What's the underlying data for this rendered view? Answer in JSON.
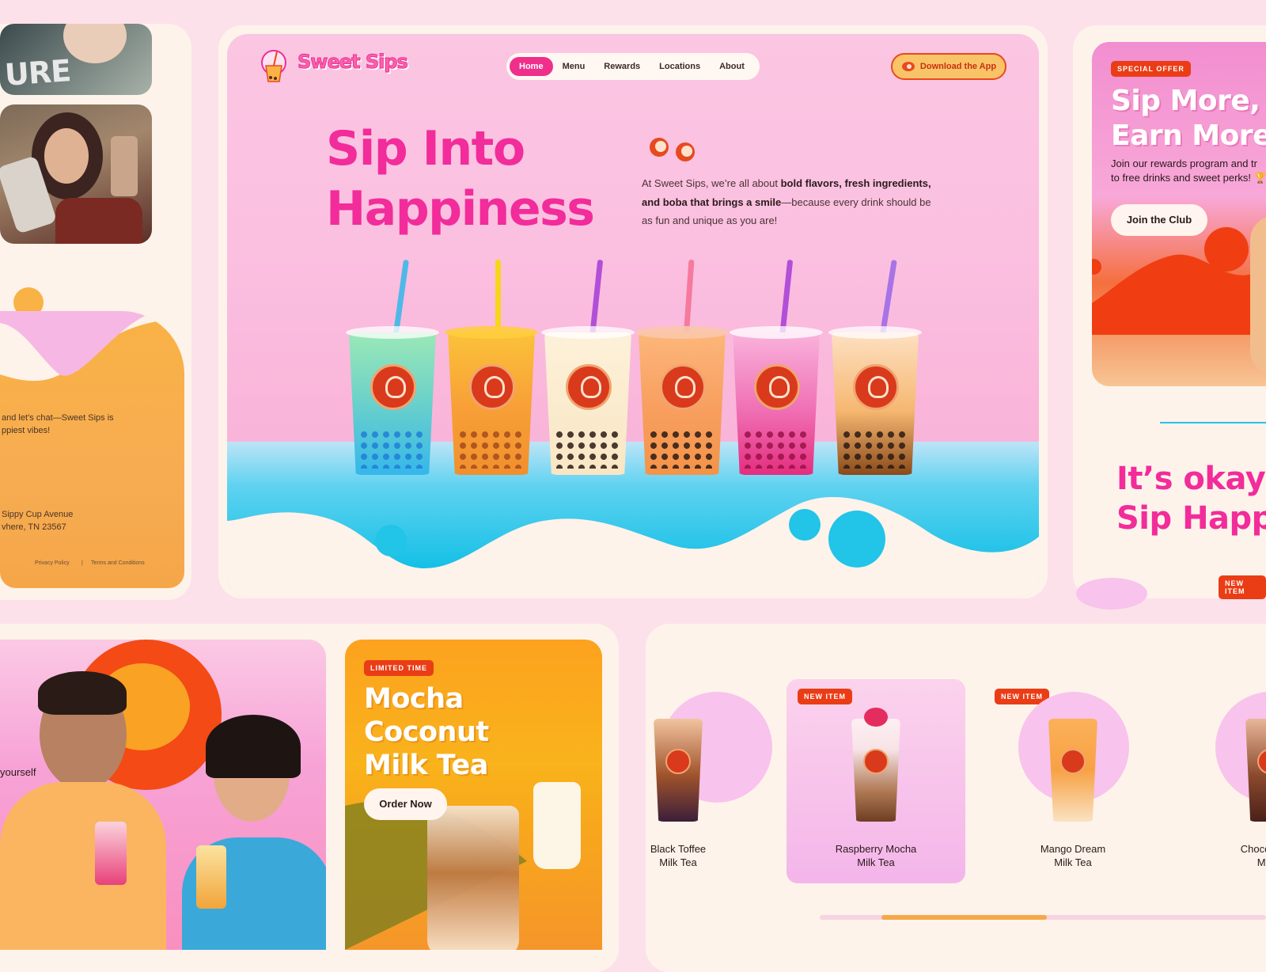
{
  "brand": {
    "name": "Sweet Sips"
  },
  "nav": {
    "items": [
      "Home",
      "Menu",
      "Rewards",
      "Locations",
      "About"
    ],
    "active": "Home"
  },
  "header": {
    "download_label": "Download the App"
  },
  "hero": {
    "title_line1": "Sip Into",
    "title_line2": "Happiness",
    "desc_intro": "At Sweet Sips, we’re all about ",
    "desc_bold1": "bold flavors, fresh ingredients, and boba that brings a smile",
    "desc_rest": "—because every drink should be as fun and unique as you are!"
  },
  "left_panel": {
    "photo_text": "URE",
    "chat_line1": "and let’s chat—Sweet Sips is",
    "chat_line2": "ppiest vibes!",
    "address_line1": "Sippy Cup Avenue",
    "address_line2": "vhere, TN 23567",
    "privacy": "Privacy Policy",
    "separator": "|",
    "terms": "Terms and Conditions"
  },
  "offer": {
    "tag": "SPECIAL OFFER",
    "title_line1": "Sip More,",
    "title_line2": "Earn More",
    "desc_line1": "Join our rewards program and tr",
    "desc_line2": "to free drinks and sweet perks! 🏆",
    "button": "Join the Club"
  },
  "okay": {
    "line1": "It’s okay—",
    "line2": "Sip Happe",
    "tag": "NEW ITEM"
  },
  "couple": {
    "text": "yourself"
  },
  "mocha": {
    "tag": "LIMITED TIME",
    "title_line1": "Mocha",
    "title_line2": "Coconut",
    "title_line3": "Milk Tea",
    "button": "Order Now"
  },
  "products": [
    {
      "line1": "Black Toffee",
      "line2": "Milk Tea",
      "tag": ""
    },
    {
      "line1": "Raspberry Mocha",
      "line2": "Milk Tea",
      "tag": "NEW ITEM"
    },
    {
      "line1": "Mango Dream",
      "line2": "Milk Tea",
      "tag": "NEW ITEM"
    },
    {
      "line1": "Chocolate",
      "line2": "Mil",
      "tag": ""
    }
  ],
  "carousel": {
    "progress": 0.37
  },
  "colors": {
    "accent": "#f22c9a",
    "orange": "#ea3d16",
    "cream": "#fdf3ea",
    "cyan": "#22c4e8"
  }
}
